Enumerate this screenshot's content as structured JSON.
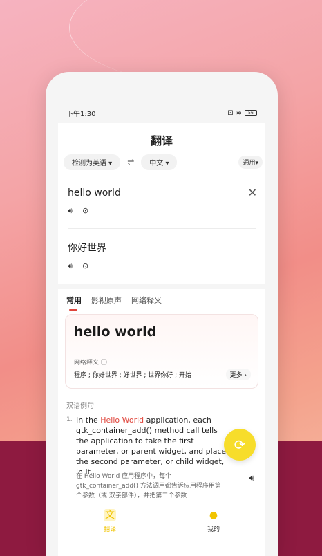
{
  "status": {
    "time": "下午1:30",
    "battery": "56"
  },
  "header": {
    "title": "翻译"
  },
  "langbar": {
    "source": "检测为英语",
    "target": "中文",
    "mode": "通用"
  },
  "source": {
    "text": "hello world"
  },
  "target": {
    "text": "你好世界"
  },
  "tabs": [
    {
      "label": "常用"
    },
    {
      "label": "影视原声"
    },
    {
      "label": "网络释义"
    }
  ],
  "card": {
    "word": "hello world",
    "label": "网络释义",
    "definitions": "程序 ; 你好世界 ; 好世界 ; 世界你好 ; 开始",
    "more": "更多"
  },
  "examples": {
    "section": "双语例句",
    "items": [
      {
        "num": "1.",
        "en_before": "In the ",
        "en_highlight": "Hello World",
        "en_after": " application, each gtk_container_add() method call tells the application to take the first parameter, or parent widget, and place the second parameter, or child widget, in it.",
        "zh": "在 Hello World 应用程序中，每个 gtk_container_add() 方法调用都告诉应用程序用第一个参数（或 双亲部件），并把第二个参数"
      }
    ]
  },
  "nav": [
    {
      "label": "翻译",
      "icon": "translate-icon"
    },
    {
      "label": "我的",
      "icon": "profile-icon"
    }
  ],
  "colors": {
    "accent": "#e0453b",
    "fab": "#f7dd2b"
  }
}
